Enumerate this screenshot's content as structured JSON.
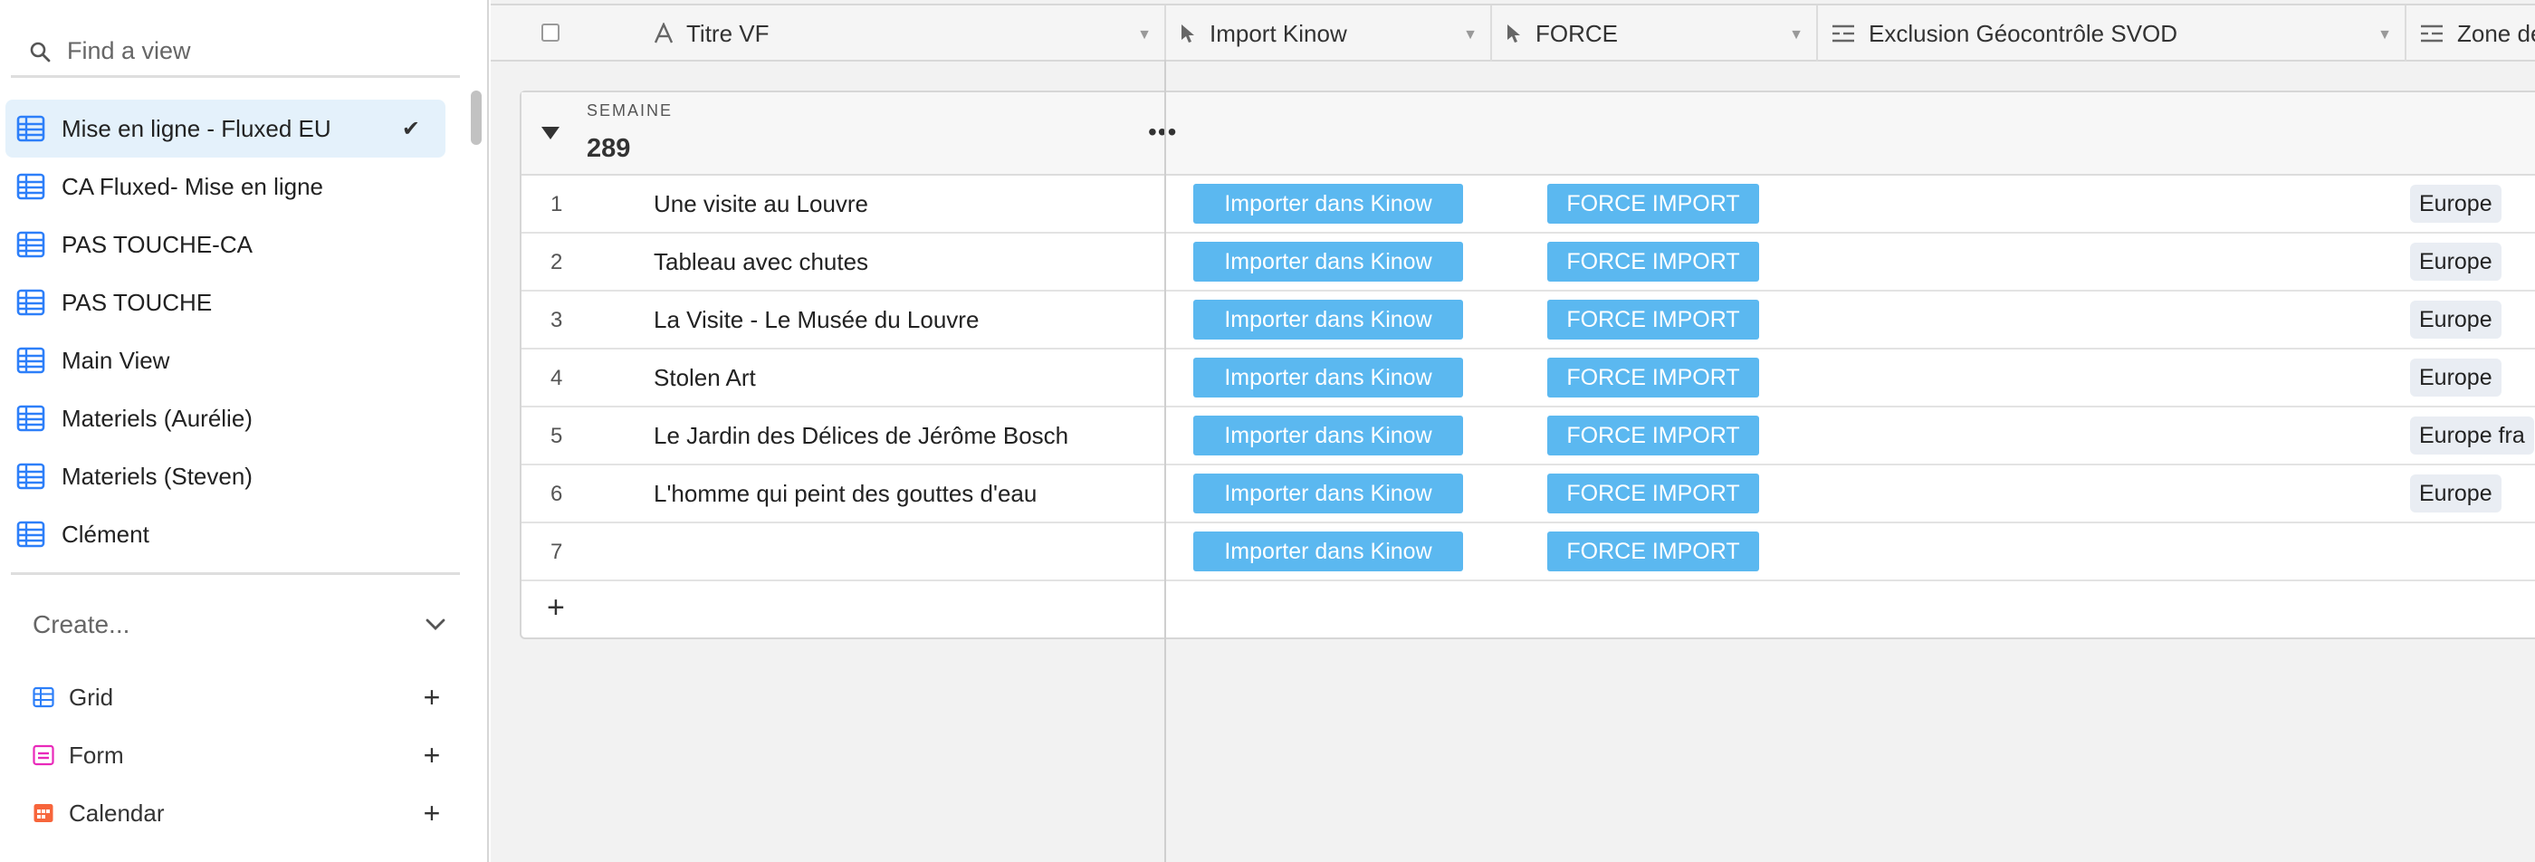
{
  "sidebar": {
    "search": {
      "placeholder": "Find a view"
    },
    "views": [
      {
        "label": "Mise en ligne - Fluxed EU",
        "active": true
      },
      {
        "label": "CA Fluxed- Mise en ligne"
      },
      {
        "label": "PAS TOUCHE-CA"
      },
      {
        "label": "PAS TOUCHE"
      },
      {
        "label": "Main View"
      },
      {
        "label": "Materiels (Aurélie)"
      },
      {
        "label": "Materiels (Steven)"
      },
      {
        "label": "Clément"
      }
    ],
    "create": {
      "label": "Create...",
      "items": [
        {
          "label": "Grid",
          "color": "#2d7ff9"
        },
        {
          "label": "Form",
          "color": "#e929ba"
        },
        {
          "label": "Calendar",
          "color": "#f7653b"
        }
      ]
    }
  },
  "header": {
    "columns": [
      {
        "label": "Titre VF",
        "icon": "text-icon"
      },
      {
        "label": "Import Kinow",
        "icon": "cursor-icon"
      },
      {
        "label": "FORCE",
        "icon": "cursor-icon"
      },
      {
        "label": "Exclusion Géocontrôle SVOD",
        "icon": "multi-select-icon"
      },
      {
        "label": "Zone de",
        "icon": "multi-select-icon"
      }
    ]
  },
  "group": {
    "label": "SEMAINE",
    "value": "289"
  },
  "rows": [
    {
      "num": "1",
      "title": "Une visite au Louvre",
      "import": "Importer dans Kinow",
      "force": "FORCE IMPORT",
      "zone": "Europe"
    },
    {
      "num": "2",
      "title": "Tableau avec chutes",
      "import": "Importer dans Kinow",
      "force": "FORCE IMPORT",
      "zone": "Europe"
    },
    {
      "num": "3",
      "title": "La Visite - Le Musée du Louvre",
      "import": "Importer dans Kinow",
      "force": "FORCE IMPORT",
      "zone": "Europe"
    },
    {
      "num": "4",
      "title": "Stolen Art",
      "import": "Importer dans Kinow",
      "force": "FORCE IMPORT",
      "zone": "Europe"
    },
    {
      "num": "5",
      "title": "Le Jardin des Délices de Jérôme Bosch",
      "import": "Importer dans Kinow",
      "force": "FORCE IMPORT",
      "zone": "Europe fra"
    },
    {
      "num": "6",
      "title": "L'homme qui peint des gouttes d'eau",
      "import": "Importer dans Kinow",
      "force": "FORCE IMPORT",
      "zone": "Europe"
    },
    {
      "num": "7",
      "title": "",
      "import": "Importer dans Kinow",
      "force": "FORCE IMPORT",
      "zone": ""
    }
  ],
  "add_row": {
    "label": "+"
  },
  "colors": {
    "button": "#5bb8f0",
    "active_view": "#e4f1fb",
    "grid_icon": "#2d7ff9"
  }
}
